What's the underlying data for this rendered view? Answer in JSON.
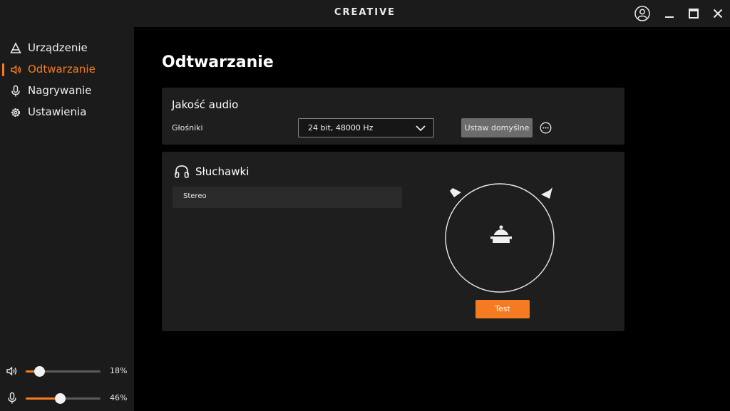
{
  "app": {
    "brand": "CREATIVE"
  },
  "window_controls": {
    "account": "user-circle-icon",
    "minimize": "minimize-icon",
    "maximize": "maximize-icon",
    "close": "close-icon"
  },
  "sidebar": {
    "items": [
      {
        "label": "Urządzenie",
        "icon": "device-icon",
        "active": false
      },
      {
        "label": "Odtwarzanie",
        "icon": "speaker-icon",
        "active": true
      },
      {
        "label": "Nagrywanie",
        "icon": "microphone-icon",
        "active": false
      },
      {
        "label": "Ustawienia",
        "icon": "gear-icon",
        "active": false
      }
    ],
    "volume": {
      "icon": "speaker-volume-icon",
      "value_text": "18%",
      "level": 0.18
    },
    "mic": {
      "icon": "microphone-icon",
      "value_text": "46%",
      "level": 0.46
    }
  },
  "main": {
    "title": "Odtwarzanie",
    "audio_quality": {
      "title": "Jakość audio",
      "device_label": "Głośniki",
      "format_value": "24 bit, 48000 Hz",
      "set_default_label": "Ustaw domyślne",
      "more_icon": "more-options-icon"
    },
    "headphones": {
      "title": "Słuchawki",
      "icon": "headphones-icon",
      "mode_value": "Stereo",
      "test_label": "Test"
    }
  },
  "colors": {
    "accent": "#f47b20",
    "background": "#000000",
    "panel": "#1e1e1e",
    "sidebar": "#1b1b1b"
  }
}
